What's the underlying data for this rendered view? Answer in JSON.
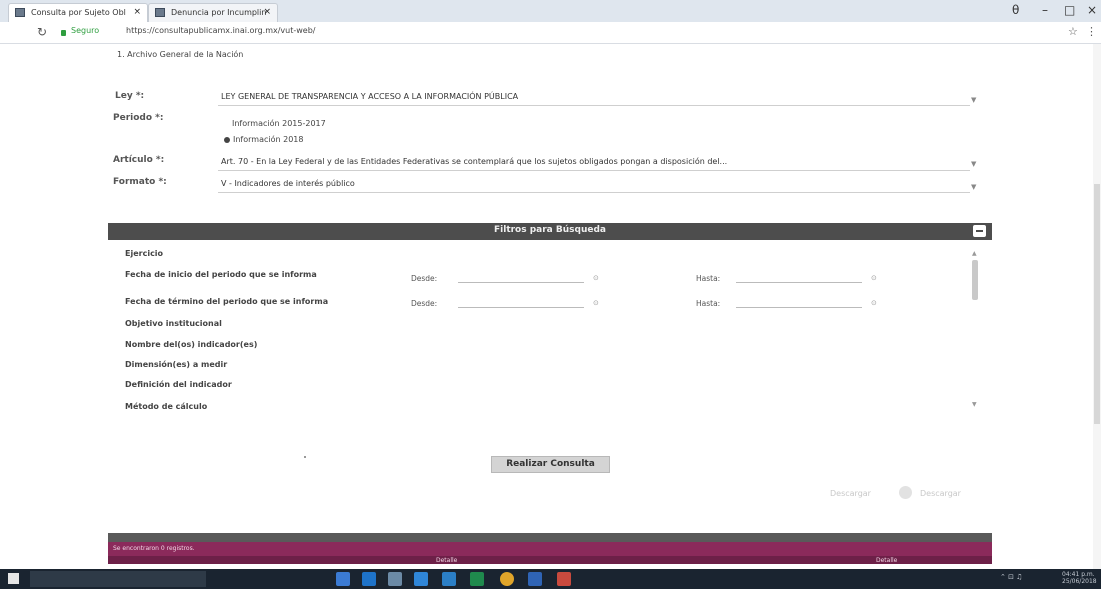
{
  "browser": {
    "tabs": [
      {
        "label": "Consulta por Sujeto Obl",
        "close": "×"
      },
      {
        "label": "Denuncia por Incumplin",
        "close": "×"
      }
    ],
    "secure_label": "Seguro",
    "url": "https://consultapublicamx.inai.org.mx/vut-web/",
    "controls": {
      "minimize": "–",
      "maximize": "□",
      "close": "×",
      "profile": "θ"
    }
  },
  "subject": "1. Archivo General de la Nación",
  "form": {
    "ley": {
      "label": "Ley *:",
      "value": "LEY GENERAL DE TRANSPARENCIA Y ACCESO A LA INFORMACIÓN PÚBLICA"
    },
    "periodo": {
      "label": "Periodo *:",
      "options": [
        "Información 2015-2017",
        "Información 2018"
      ],
      "selected": "Información 2018"
    },
    "articulo": {
      "label": "Artículo *:",
      "value": "Art. 70 - En la Ley Federal y de las Entidades Federativas se contemplará que los sujetos obligados pongan a disposición del..."
    },
    "formato": {
      "label": "Formato *:",
      "value": "V - Indicadores de interés público"
    }
  },
  "filters": {
    "title": "Filtros para Búsqueda",
    "rows": [
      "Ejercicio",
      "Fecha de inicio del periodo que se informa",
      "Fecha de término del periodo que se informa",
      "Objetivo institucional",
      "Nombre del(os) indicador(es)",
      "Dimensión(es) a medir",
      "Definición del indicador",
      "Método de cálculo"
    ],
    "desde_label": "Desde:",
    "hasta_label": "Hasta:"
  },
  "actions": {
    "consult_label": "Realizar Consulta",
    "download_1": "Descargar",
    "download_2": "Descargar"
  },
  "results": {
    "message": "Se encontraron 0 registros.",
    "col_left": "Detalle",
    "col_right": "Detalle"
  },
  "colors": {
    "panel_header": "#4d4d4d",
    "results_bar": "#8b2a5b",
    "secure_green": "#2e9e3f"
  },
  "taskbar": {
    "tray": "⌃ ⊡ ♫",
    "clock": "04:41 p.m.",
    "date": "25/06/2018"
  }
}
